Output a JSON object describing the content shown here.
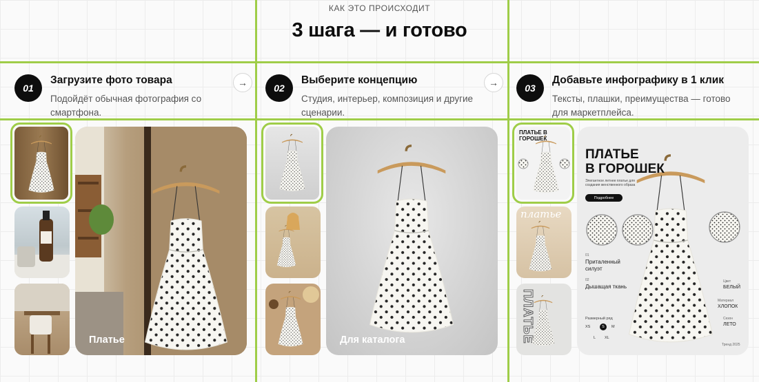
{
  "header": {
    "eyebrow": "КАК ЭТО ПРОИСХОДИТ",
    "title": "3 шага — и готово"
  },
  "steps": [
    {
      "num": "01",
      "title": "Загрузите фото товара",
      "desc": "Подойдёт обычная фотография со смартфона.",
      "caption": "Платье"
    },
    {
      "num": "02",
      "title": "Выберите концепцию",
      "desc": "Студия, интерьер, композиция и другие сценарии.",
      "caption": "Для каталога"
    },
    {
      "num": "03",
      "title": "Добавьте инфографику в 1 клик",
      "desc": "Тексты, плашки, преимущества — готово для маркетплейса.",
      "caption": ""
    }
  ],
  "infographic": {
    "thumb_title": "ПЛАТЬЕ В ГОРОШЕК",
    "thumb2_text": "платье",
    "thumb3_text": "ПЛАТЬЕ",
    "title_line1": "ПЛАТЬЕ",
    "title_line2": "В ГОРОШЕК",
    "subtitle": "Элегантное летнее платье для создания женственного образа",
    "more_button": "Подробнее",
    "feat1_num": "01",
    "feat1_text": "Приталенный силуэт",
    "feat2_num": "02",
    "feat2_text": "Дышащая ткань",
    "color_label": "Цвет",
    "color_value": "БЕЛЫЙ",
    "material_label": "Материал",
    "material_value": "ХЛОПОК",
    "season_label": "Сезон",
    "season_value": "ЛЕТО",
    "size_label": "Размерный ряд",
    "sizes": [
      "XS",
      "S",
      "M",
      "L",
      "XL"
    ],
    "trend": "Тренд 2025"
  },
  "colors": {
    "accent_green": "#9fcd48",
    "badge_bg": "#0d0d0d"
  }
}
